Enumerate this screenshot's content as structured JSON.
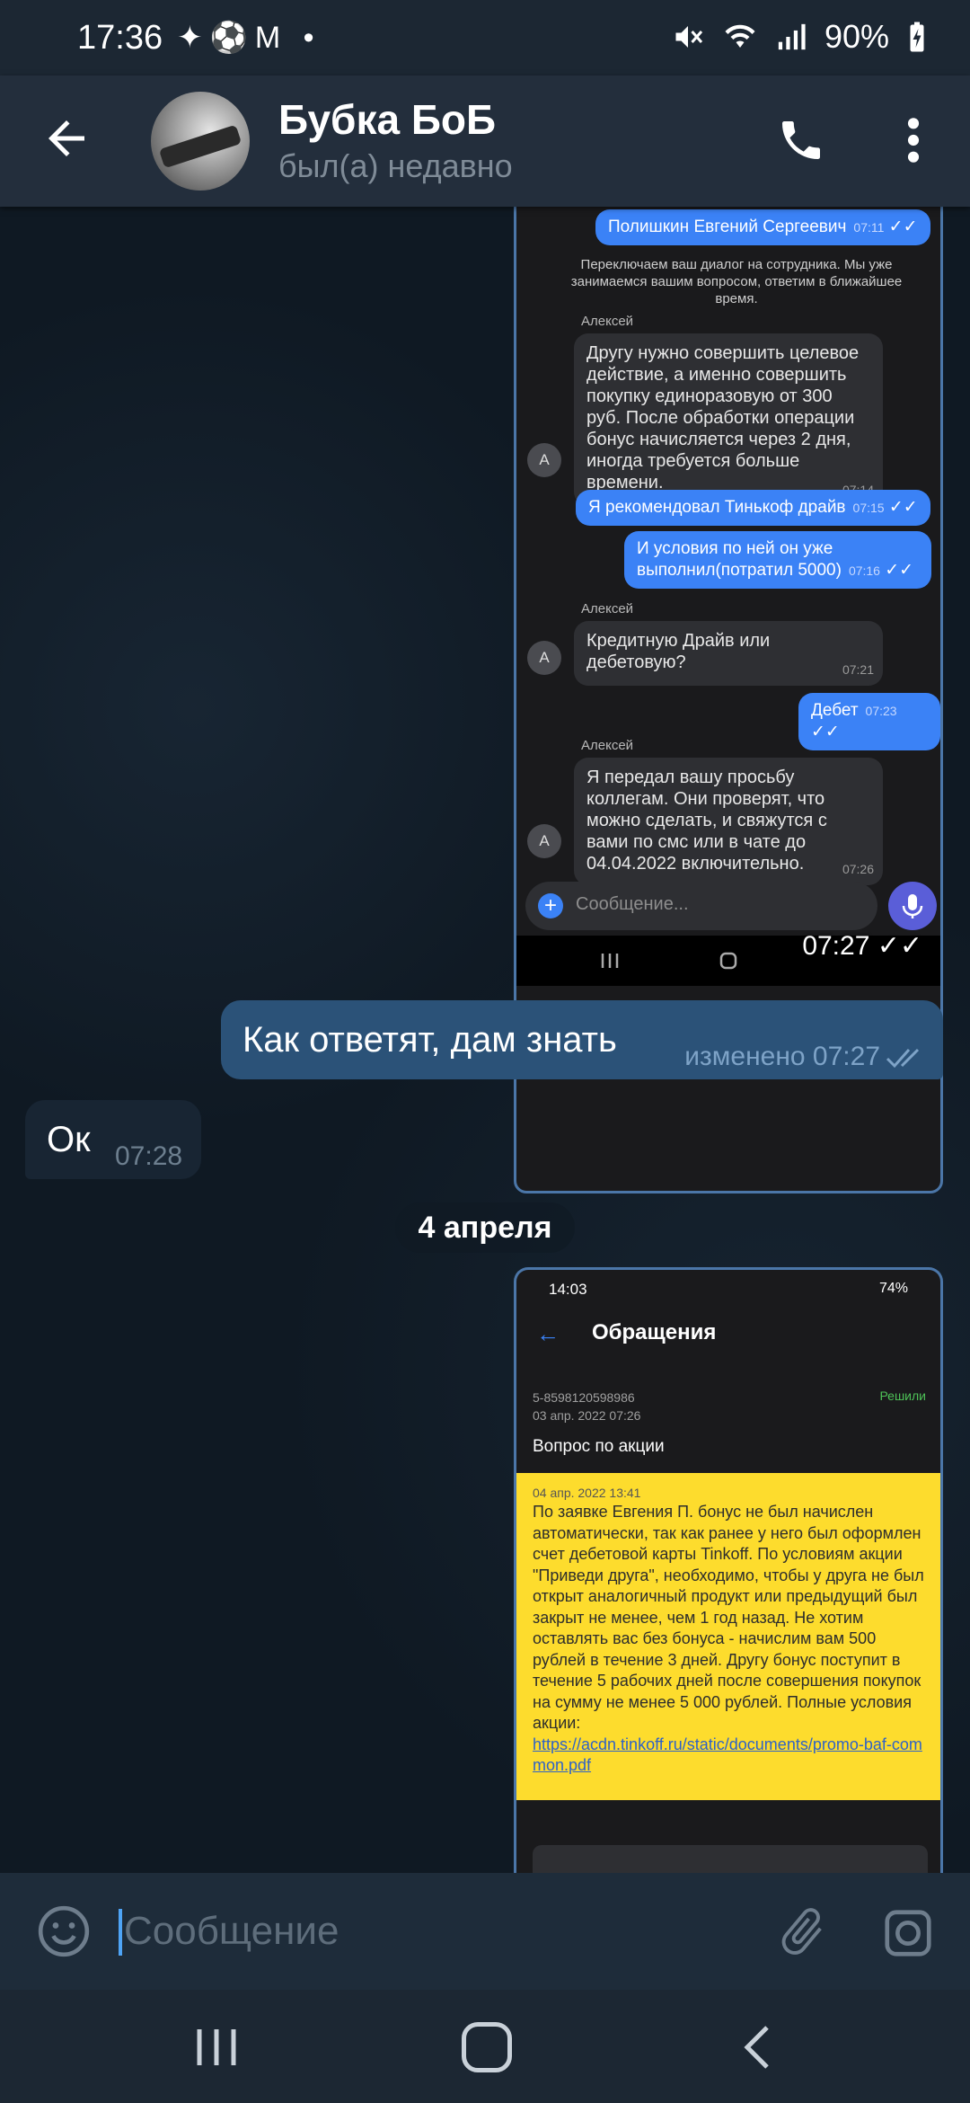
{
  "status_bar": {
    "time": "17:36",
    "notification_icons": "✦⚽M •",
    "battery": "90%"
  },
  "header": {
    "title": "Бубка БоБ",
    "status": "был(а) недавно"
  },
  "messages": {
    "outgoing_text": "Как ответят, дам знать",
    "outgoing_meta": "изменено 07:27",
    "incoming_text": "Ок",
    "incoming_time": "07:28",
    "date_chip": "4 апреля",
    "photo1_time": "07:27"
  },
  "screenshot1": {
    "out1": {
      "text": "Полишкин Евгений Сергеевич",
      "time": "07:11"
    },
    "notice": "Переключаем ваш диалог на сотрудника. Мы уже занимаемся вашим вопросом, ответим в ближайшее время.",
    "sender": "Алексей",
    "in1": {
      "text": "Другу нужно совершить целевое действие, а именно совершить покупку единоразовую от 300 руб. После обработки операции бонус начисляется через 2 дня, иногда требуется больше времени.",
      "time": "07:14"
    },
    "out2": {
      "text": "Я рекомендовал Тинькоф драйв",
      "time": "07:15"
    },
    "out3": {
      "text": "И условия по ней он уже выполнил(потратил 5000)",
      "time": "07:16"
    },
    "in2": {
      "text": "Кредитную Драйв или дебетовую?",
      "time": "07:21"
    },
    "out4": {
      "text": "Дебет",
      "time": "07:23"
    },
    "in3": {
      "text": "Я передал вашу просьбу коллегам. Они проверят, что можно сделать, и свяжутся с вами по смс или в чате до 04.04.2022 включительно.",
      "time": "07:26"
    },
    "avatar_letter": "A",
    "input_placeholder": "Сообщение..."
  },
  "screenshot2": {
    "status_time": "14:03",
    "status_battery": "74%",
    "title": "Обращения",
    "ticket_number": "5-8598120598986",
    "ticket_date": "03 апр. 2022 07:26",
    "ticket_status": "Решили",
    "question": "Вопрос по акции",
    "answer_date": "04 апр. 2022 13:41",
    "answer_text": "По заявке Евгения П. бонус не был начислен автоматически, так как ранее у него был оформлен счет дебетовой карты Tinkoff. По условиям акции \"Приведи друга\", необходимо, чтобы у друга не был открыт аналогичный продукт или предыдущий был закрыт не менее, чем 1 год назад. Не хотим оставлять вас без бонуса - начислим вам 500 рублей в течение 3 дней. Другу бонус поступит в течение 5 рабочих дней после совершения покупок на сумму не менее 5 000 рублей. Полные условия акции:",
    "answer_link": "https://acdn.tinkoff.ru/static/documents/promo-baf-common.pdf"
  },
  "composer": {
    "placeholder": "Сообщение"
  }
}
